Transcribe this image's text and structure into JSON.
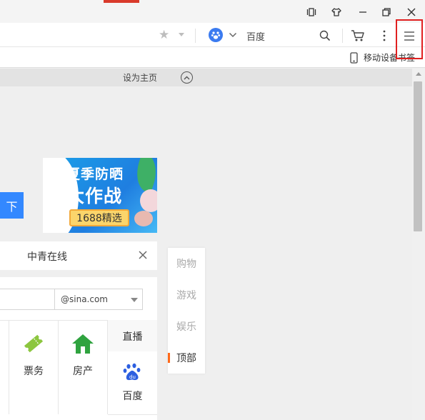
{
  "window": {
    "controls": [
      "reader-mode-icon",
      "skin-icon",
      "minimize-icon",
      "restore-icon",
      "close-icon"
    ]
  },
  "toolbar": {
    "search_engine_label": "百度",
    "bookmark_mobile_label": "移动设备书签",
    "icons": [
      "star-icon",
      "baidu-paw-icon",
      "search-icon",
      "cart-icon",
      "more-vertical-icon",
      "menu-icon"
    ]
  },
  "page": {
    "set_home_label": "设为主页",
    "blue_button_label": "下",
    "banner": {
      "title": "夏季防晒",
      "big_title": "大作战",
      "badge": "1688精选"
    },
    "news_bar": {
      "text": "中青在线"
    },
    "mail": {
      "domain": "@sina.com"
    },
    "services": [
      {
        "label": "票务",
        "icon": "ticket-icon"
      },
      {
        "label": "房产",
        "icon": "house-icon"
      }
    ],
    "side_links": [
      {
        "label": "直播"
      },
      {
        "label": "百度",
        "icon": "baidu-paw-icon"
      }
    ],
    "float_nav": [
      {
        "label": "购物",
        "active": false
      },
      {
        "label": "游戏",
        "active": false
      },
      {
        "label": "娱乐",
        "active": false
      },
      {
        "label": "顶部",
        "active": true
      }
    ]
  },
  "colors": {
    "accent_blue": "#3388ff",
    "highlight_red": "#e02020",
    "active_orange": "#ff6a1a",
    "house_green": "#2fa33f"
  }
}
